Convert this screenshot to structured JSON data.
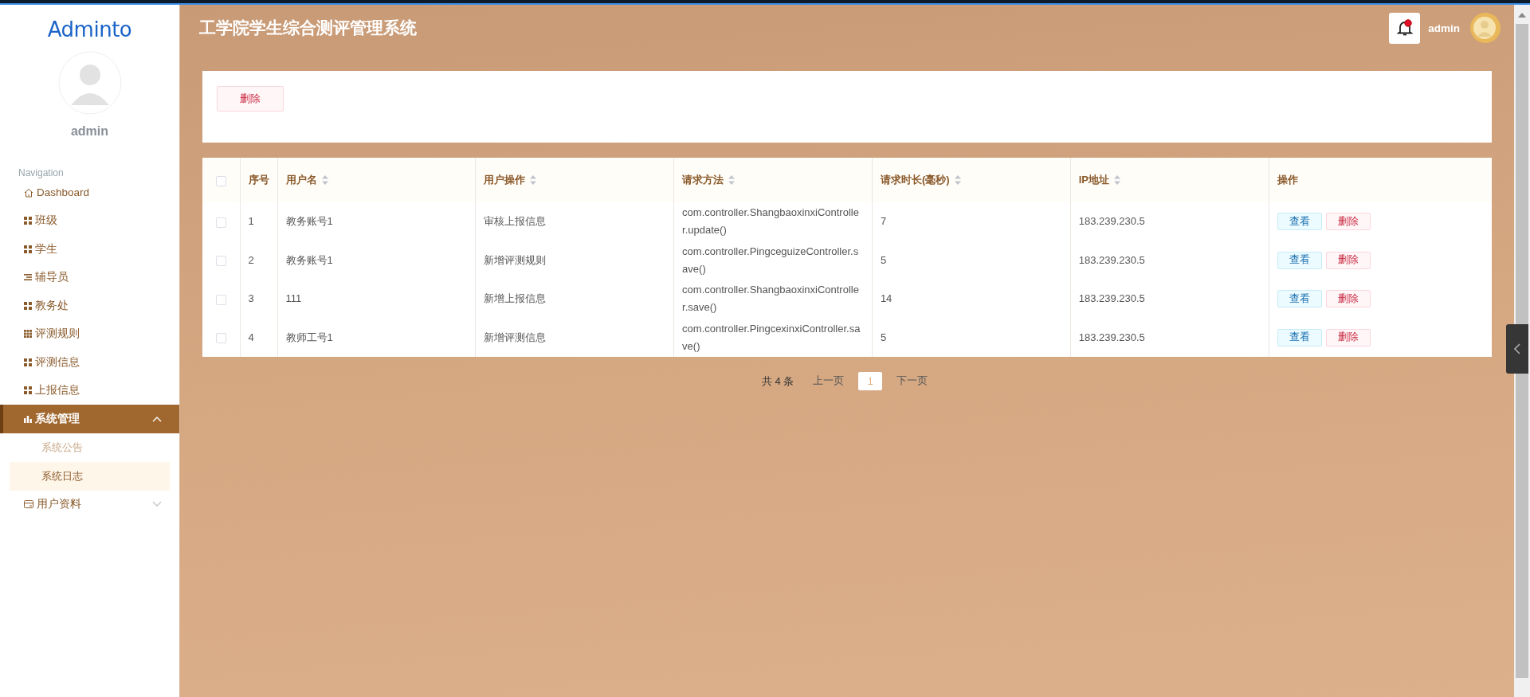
{
  "sidebar": {
    "logo": "Adminto",
    "user": "admin",
    "nav_heading": "Navigation",
    "items": [
      {
        "label": "Dashboard",
        "selected": false
      },
      {
        "label": "班级",
        "selected": false
      },
      {
        "label": "学生",
        "selected": false
      },
      {
        "label": "辅导员",
        "selected": false
      },
      {
        "label": "教务处",
        "selected": false
      },
      {
        "label": "评测规则",
        "selected": false
      },
      {
        "label": "评测信息",
        "selected": false
      },
      {
        "label": "上报信息",
        "selected": false
      },
      {
        "label": "系统管理",
        "selected": true,
        "expanded": true,
        "children": [
          {
            "label": "系统公告",
            "selected": false
          },
          {
            "label": "系统日志",
            "selected": true
          }
        ]
      },
      {
        "label": "用户资料",
        "selected": false,
        "expanded": false
      }
    ]
  },
  "header": {
    "title": "工学院学生综合测评管理系统",
    "has_alert": true,
    "user": "admin"
  },
  "toolbar": {
    "buttons": [
      "删除"
    ]
  },
  "table": {
    "all_checked": false,
    "columns": [
      {
        "label": "序号",
        "sortable": false
      },
      {
        "label": "用户名",
        "sortable": true
      },
      {
        "label": "用户操作",
        "sortable": true
      },
      {
        "label": "请求方法",
        "sortable": true
      },
      {
        "label": "请求时长(毫秒)",
        "sortable": true
      },
      {
        "label": "IP地址",
        "sortable": true
      },
      {
        "label": "操作",
        "sortable": false
      }
    ],
    "rows": [
      {
        "selected": false,
        "cells": [
          "1",
          "教务账号1",
          "审核上报信息",
          "com.controller.ShangbaoxinxiController.update()",
          "7",
          "183.239.230.5"
        ],
        "actions": [
          "查看",
          "删除"
        ]
      },
      {
        "selected": false,
        "cells": [
          "2",
          "教务账号1",
          "新增评测规则",
          "com.controller.PingceguizeController.save()",
          "5",
          "183.239.230.5"
        ],
        "actions": [
          "查看",
          "删除"
        ]
      },
      {
        "selected": false,
        "cells": [
          "3",
          "111",
          "新增上报信息",
          "com.controller.ShangbaoxinxiController.save()",
          "14",
          "183.239.230.5"
        ],
        "actions": [
          "查看",
          "删除"
        ]
      },
      {
        "selected": false,
        "cells": [
          "4",
          "教师工号1",
          "新增评测信息",
          "com.controller.PingcexinxiController.save()",
          "5",
          "183.239.230.5"
        ],
        "actions": [
          "查看",
          "删除"
        ]
      }
    ]
  },
  "pagination": {
    "total": "共 4 条",
    "prev": "上一页",
    "pages": [
      {
        "label": "1",
        "selected": true
      }
    ],
    "next": "下一页"
  }
}
